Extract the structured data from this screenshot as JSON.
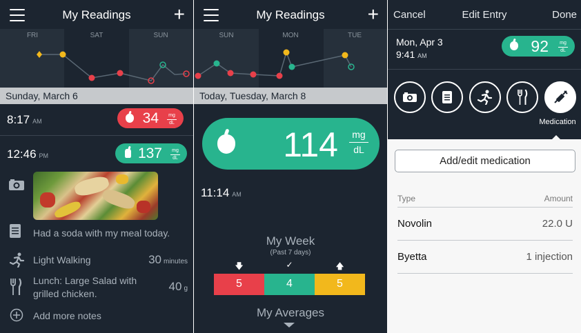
{
  "colors": {
    "background": "#1c2530",
    "chart_bg": "#26303b",
    "accent_green": "#28b48e",
    "alert_red": "#e8404a",
    "high_yellow": "#f2b81c",
    "light_panel": "#f7f7f7"
  },
  "icons": [
    "hamburger-menu",
    "plus",
    "apple",
    "camera",
    "note",
    "running",
    "fork-knife",
    "add-circle",
    "syringe",
    "arrow-down",
    "check",
    "arrow-up"
  ],
  "panel1": {
    "title": "My Readings",
    "chart_days": [
      "FRI",
      "SAT",
      "SUN"
    ],
    "date_header": "Sunday, March 6",
    "reading1": {
      "time": "8:17",
      "ampm": "AM",
      "value": "34",
      "unit_top": "mg",
      "unit_bottom": "dL"
    },
    "reading2": {
      "time": "12:46",
      "ampm": "PM",
      "value": "137",
      "unit_top": "mg",
      "unit_bottom": "dL"
    },
    "note": "Had a soda with my meal today.",
    "activity": {
      "label": "Light Walking",
      "value": "30",
      "unit": "minutes"
    },
    "meal": {
      "label": "Lunch: Large Salad with grilled chicken.",
      "value": "40",
      "unit": "g"
    },
    "add_notes": "Add more notes"
  },
  "panel2": {
    "title": "My Readings",
    "chart_days": [
      "SUN",
      "MON",
      "TUE"
    ],
    "date_header": "Today, Tuesday, March 8",
    "reading": {
      "value": "114",
      "unit_top": "mg",
      "unit_bottom": "dL",
      "time": "11:14",
      "ampm": "AM"
    },
    "week": {
      "title": "My Week",
      "subtitle": "(Past 7 days)",
      "low": "5",
      "in_range": "4",
      "high": "5"
    },
    "averages": "My Averages"
  },
  "panel3": {
    "cancel": "Cancel",
    "title": "Edit Entry",
    "done": "Done",
    "date": "Mon, Apr 3",
    "time": "9:41",
    "ampm": "AM",
    "reading": {
      "value": "92",
      "unit_top": "mg",
      "unit_bottom": "dL"
    },
    "active_label": "Medication",
    "add_button": "Add/edit medication",
    "table": {
      "col_type": "Type",
      "col_amount": "Amount",
      "rows": [
        {
          "type": "Novolin",
          "amount": "22.0 U"
        },
        {
          "type": "Byetta",
          "amount": "1 injection"
        }
      ]
    }
  }
}
